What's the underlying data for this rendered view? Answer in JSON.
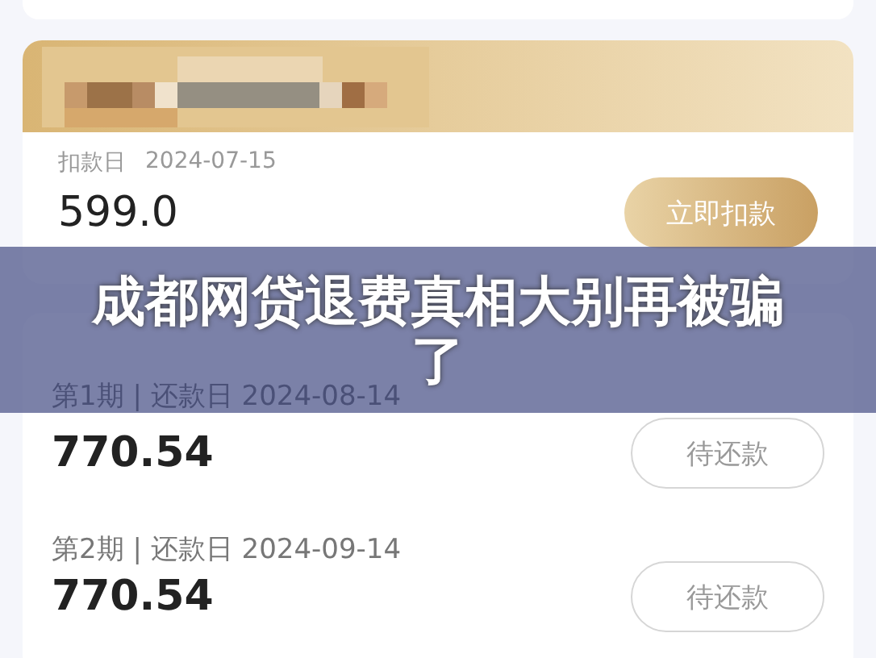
{
  "deduction_card": {
    "date_label": "扣款日",
    "date": "2024-07-15",
    "amount": "599.0",
    "button": {
      "label": "立即扣款",
      "kind": "primary"
    }
  },
  "installments": [
    {
      "label": "第1期 | 还款日 2024-08-14",
      "amount": "770.54",
      "button": {
        "label": "待还款",
        "kind": "outline"
      }
    },
    {
      "label": "第2期 | 还款日 2024-09-14",
      "amount": "770.54",
      "button": {
        "label": "待还款",
        "kind": "outline"
      }
    }
  ],
  "banner": {
    "title": "成都网贷退费真相大别再被骗了"
  }
}
